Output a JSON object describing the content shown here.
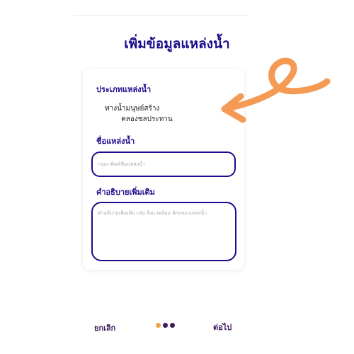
{
  "page": {
    "title": "เพิ่มข้อมูลแหล่งน้ำ"
  },
  "form": {
    "water_type": {
      "label": "ประเภทแหล่งน้ำ",
      "selected_lines": [
        "ทางน้ำมนุษย์สร้าง",
        "คลองชลประทาน"
      ]
    },
    "water_name": {
      "label": "ชื่อแหล่งน้ำ",
      "value": "",
      "placeholder": "กรุณาพิมพ์ชื่อแหล่งน้ำ"
    },
    "description": {
      "label": "คำอธิบายเพิ่มเติม",
      "value": "",
      "placeholder": "คำอธิบายเพิ่มเติม เช่น สิ่งแวดล้อม ลักษณะแหล่งน้ำ"
    }
  },
  "footer": {
    "cancel_label": "ยกเลิก",
    "next_label": "ต่อไป",
    "step_dot_colors": [
      "#f3a04a",
      "#3d1b5c",
      "#3d1b5c"
    ]
  },
  "colors": {
    "primary": "#1c0c8c",
    "footer_text": "#3d1b5c",
    "arrow_annotation": "#f59a55"
  },
  "icons": {
    "annotation": "curved-arrow-icon"
  }
}
